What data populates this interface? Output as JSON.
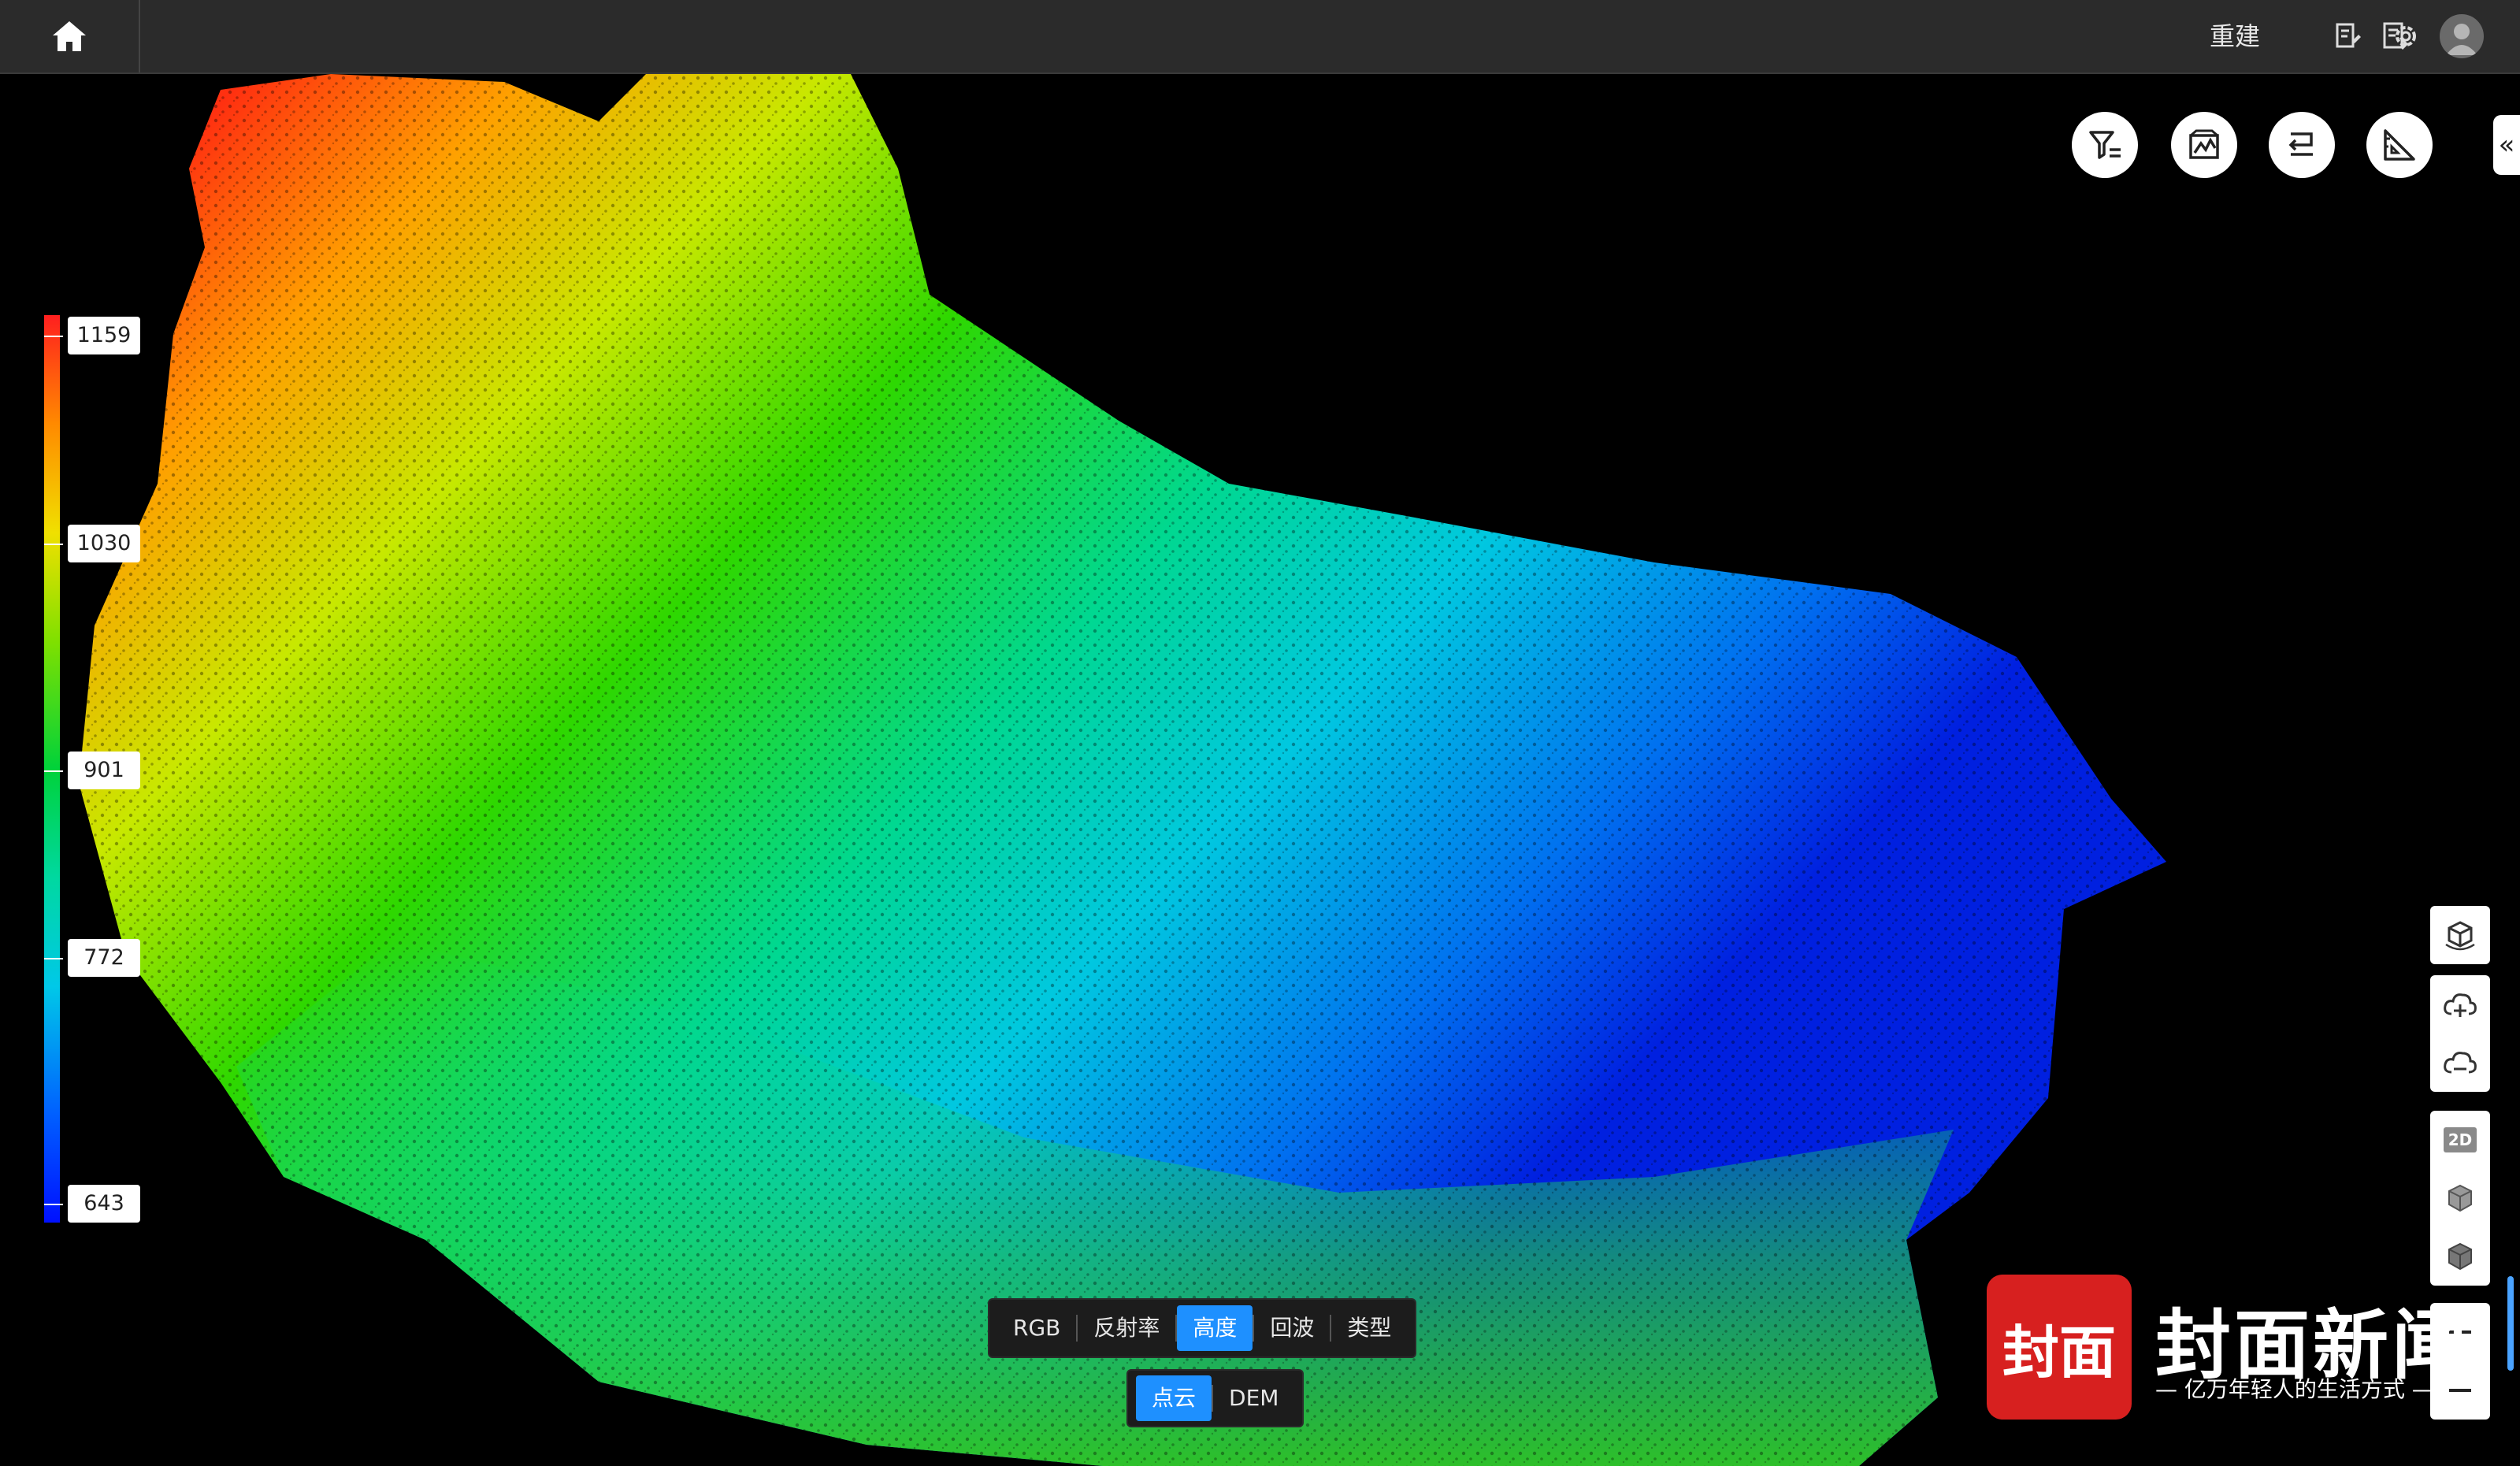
{
  "topbar": {
    "rebuild_label": "重建"
  },
  "legend": {
    "values": [
      "1159",
      "1030",
      "901",
      "772",
      "643"
    ]
  },
  "render_modes": {
    "items": [
      "RGB",
      "反射率",
      "高度",
      "回波",
      "类型"
    ],
    "active": "高度"
  },
  "data_modes": {
    "items": [
      "点云",
      "DEM"
    ],
    "active": "点云"
  },
  "watermark": {
    "badge": "封面",
    "title": "封面新闻",
    "subtitle": "— 亿万年轻人的生活方式 —"
  },
  "side_toolbar": {
    "view_2d_label": "2D"
  },
  "colors": {
    "accent": "#1e90ff",
    "topbar": "#2b2b2b",
    "background": "#000000"
  }
}
